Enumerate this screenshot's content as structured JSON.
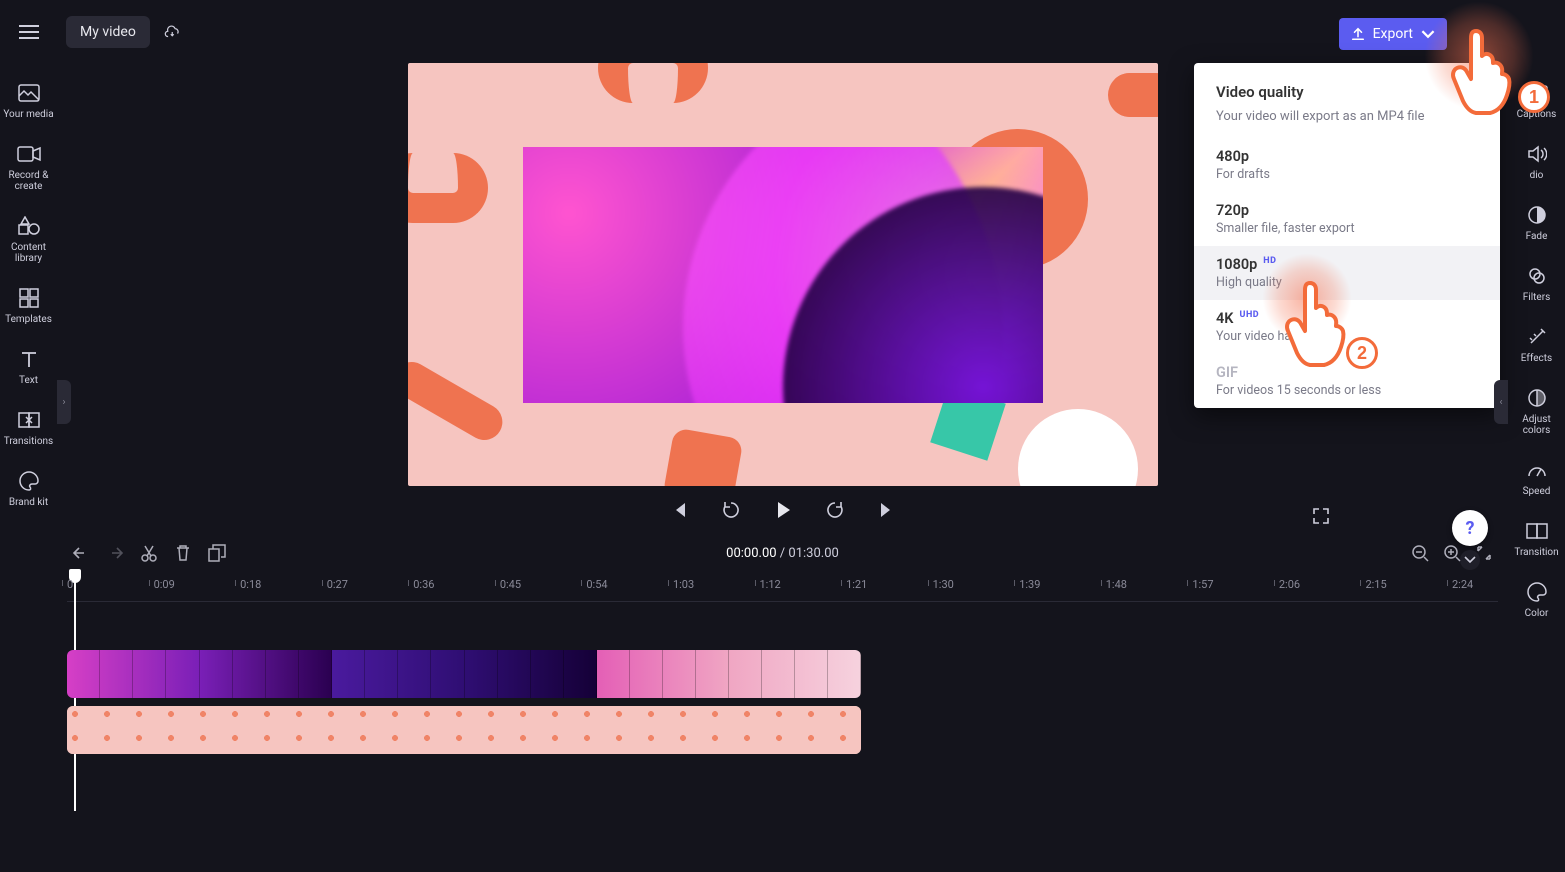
{
  "header": {
    "title": "My video",
    "export_label": "Export"
  },
  "left_nav": [
    {
      "id": "your-media",
      "label": "Your media"
    },
    {
      "id": "record-create",
      "label": "Record & create"
    },
    {
      "id": "content-library",
      "label": "Content library"
    },
    {
      "id": "templates",
      "label": "Templates"
    },
    {
      "id": "text",
      "label": "Text"
    },
    {
      "id": "transitions",
      "label": "Transitions"
    },
    {
      "id": "brand-kit",
      "label": "Brand kit"
    }
  ],
  "right_nav": [
    {
      "id": "captions",
      "label": "Captions"
    },
    {
      "id": "audio",
      "label": "dio"
    },
    {
      "id": "fade",
      "label": "Fade"
    },
    {
      "id": "filters",
      "label": "Filters"
    },
    {
      "id": "effects",
      "label": "Effects"
    },
    {
      "id": "adjust-colors",
      "label": "Adjust colors"
    },
    {
      "id": "speed",
      "label": "Speed"
    },
    {
      "id": "transition",
      "label": "Transition"
    },
    {
      "id": "color",
      "label": "Color"
    }
  ],
  "export_menu": {
    "title": "Video quality",
    "subtitle": "Your video will export as an MP4 file",
    "options": [
      {
        "title": "480p",
        "sub": "For drafts",
        "badge": ""
      },
      {
        "title": "720p",
        "sub": "Smaller file, faster export",
        "badge": ""
      },
      {
        "title": "1080p",
        "sub": "High quality",
        "badge": "HD",
        "highlighted": true
      },
      {
        "title": "4K",
        "sub": "Your video has no 4",
        "badge": "UHD"
      },
      {
        "title": "GIF",
        "sub": "For videos 15 seconds or less",
        "badge": "",
        "disabled": true
      }
    ]
  },
  "annotations": {
    "step1": "1",
    "step2": "2"
  },
  "timeline": {
    "current": "00:00.00",
    "sep": " / ",
    "total": "01:30.00",
    "ticks": [
      "0",
      "0:09",
      "0:18",
      "0:27",
      "0:36",
      "0:45",
      "0:54",
      "1:03",
      "1:12",
      "1:21",
      "1:30",
      "1:39",
      "1:48",
      "1:57",
      "2:06",
      "2:15",
      "2:24"
    ]
  },
  "help": "?",
  "colors": {
    "accent": "#5b5cf0",
    "annot": "#f36b3a",
    "canvas_bg": "#f6c5c0"
  }
}
